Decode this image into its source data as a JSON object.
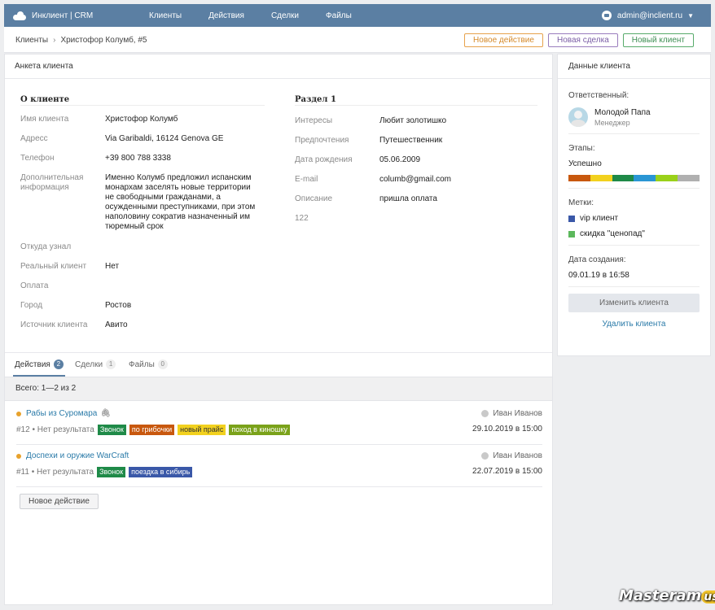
{
  "topbar": {
    "brand": "Инклиент | CRM",
    "nav": [
      "Клиенты",
      "Действия",
      "Сделки",
      "Файлы"
    ],
    "user_email": "admin@inclient.ru"
  },
  "breadcrumb": {
    "root": "Клиенты",
    "current": "Христофор Колумб, #5"
  },
  "toolbar": {
    "new_action": "Новое действие",
    "new_deal": "Новая сделка",
    "new_client": "Новый клиент"
  },
  "profile": {
    "panel_title": "Анкета клиента",
    "about_title": "О клиенте",
    "about_rows": [
      {
        "label": "Имя клиента",
        "value": "Христофор Колумб"
      },
      {
        "label": "Адресс",
        "value": "Via Garibaldi, 16124 Genova GE"
      },
      {
        "label": "Телефон",
        "value": "+39 800 788 3338"
      },
      {
        "label": "Дополнительная информация",
        "value": "Именно Колумб предложил испанским монархам заселять новые территории не свободными гражданами, а осужденными преступниками, при этом наполовину сократив назначенный им тюремный срок"
      },
      {
        "label": "Откуда узнал",
        "value": ""
      },
      {
        "label": "Реальный клиент",
        "value": "Нет"
      },
      {
        "label": "Оплата",
        "value": ""
      },
      {
        "label": "Город",
        "value": "Ростов"
      },
      {
        "label": "Источник клиента",
        "value": "Авито"
      }
    ],
    "section1_title": "Раздел 1",
    "section1_rows": [
      {
        "label": "Интересы",
        "value": "Любит золотишко"
      },
      {
        "label": "Предпочтения",
        "value": "Путешественник"
      },
      {
        "label": "Дата рождения",
        "value": "05.06.2009"
      },
      {
        "label": "E-mail",
        "value": "columb@gmail.com"
      },
      {
        "label": "Описание",
        "value": "пришла оплата"
      },
      {
        "label": "122",
        "value": ""
      }
    ]
  },
  "tabs": [
    {
      "label": "Действия",
      "count": "2"
    },
    {
      "label": "Сделки",
      "count": "1"
    },
    {
      "label": "Файлы",
      "count": "0"
    }
  ],
  "total": "Всего: 1—2 из 2",
  "actions": [
    {
      "title": "Рабы из Суромара",
      "owner": "Иван Иванов",
      "meta": "#12 • Нет результата",
      "tags": [
        {
          "label": "Звонок",
          "color": "#1f8a48"
        },
        {
          "label": "по грибочки",
          "color": "#c8580e"
        },
        {
          "label": "новый прайс",
          "color": "#f2d11e"
        },
        {
          "label": "поход в киношку",
          "color": "#7aa21a"
        }
      ],
      "date": "29.10.2019 в 15:00"
    },
    {
      "title": "Доспехи и оружие WarCraft",
      "owner": "Иван Иванов",
      "meta": "#11 • Нет результата",
      "tags": [
        {
          "label": "Звонок",
          "color": "#1f8a48"
        },
        {
          "label": "поездка в сибирь",
          "color": "#3a58a8"
        }
      ],
      "date": "22.07.2019 в 15:00"
    }
  ],
  "new_action_button": "Новое действие",
  "side": {
    "title": "Данные клиента",
    "responsible_label": "Ответственный:",
    "manager_name": "Молодой Папа",
    "manager_role": "Менеджер",
    "stages_label": "Этапы:",
    "stage_value": "Успешно",
    "stage_colors": [
      "#c8580e",
      "#f2d11e",
      "#1f8a48",
      "#2a96d4",
      "#9ad11a",
      "#b0b0b0"
    ],
    "tags_label": "Метки:",
    "tags": [
      {
        "label": "vip клиент",
        "color": "#3a58a8"
      },
      {
        "label": "скидка \"ценопад\"",
        "color": "#5cb85c"
      }
    ],
    "created_label": "Дата создания:",
    "created_value": "09.01.19 в 16:58",
    "edit_button": "Изменить клиента",
    "delete_link": "Удалить клиента"
  },
  "watermark": {
    "text": "Masteram",
    "suffix": "us"
  }
}
